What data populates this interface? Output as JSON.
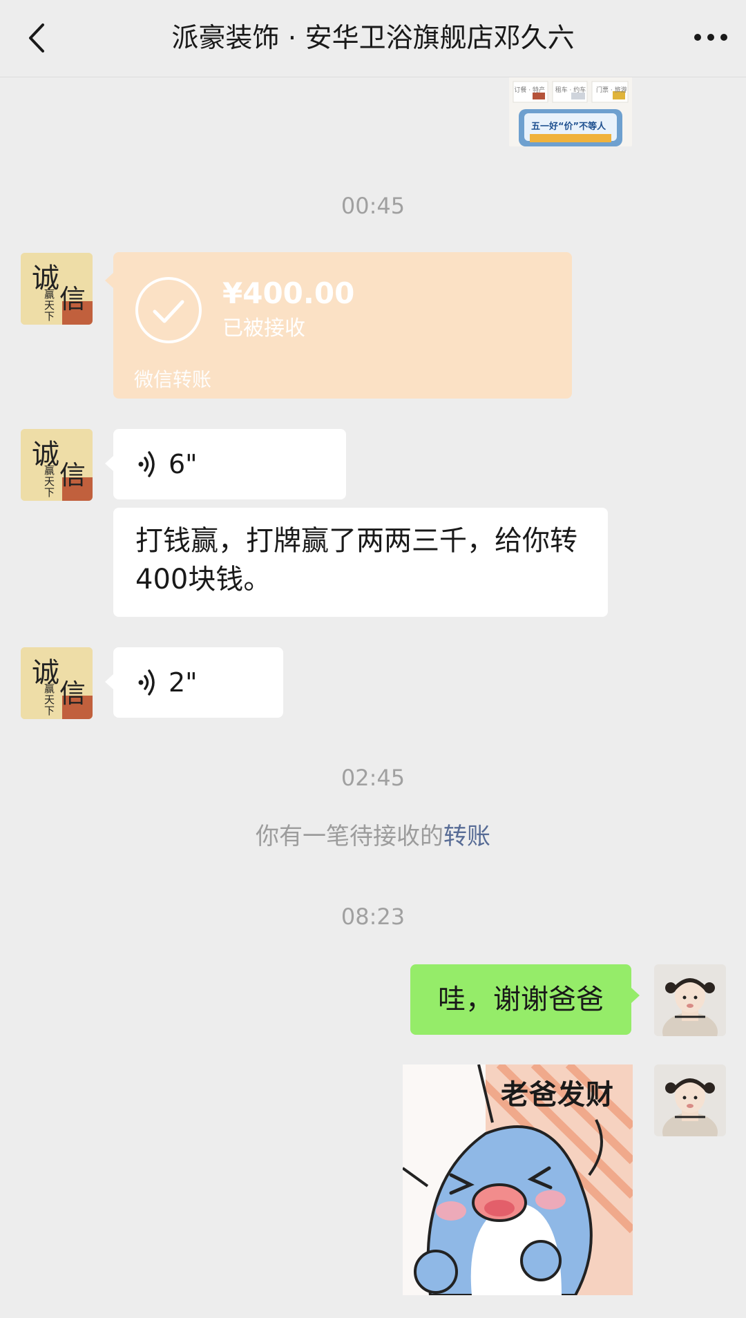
{
  "header": {
    "title": "派豪装饰 · 安华卫浴旗舰店邓久六",
    "back_icon": "chevron-left-icon",
    "more_icon": "more-dots-icon"
  },
  "previous_image": {
    "caption": "五一好“价”不等人",
    "tabs": [
      "订餐 · 特产",
      "租车 · 约车",
      "门票 · 旅游"
    ]
  },
  "timestamps": [
    "00:45",
    "02:45",
    "08:23"
  ],
  "contact_avatar": {
    "big1": "诚",
    "big2": "信",
    "small": "赢天下"
  },
  "transfer": {
    "amount": "¥400.00",
    "status": "已被接收",
    "label": "微信转账"
  },
  "voice_messages": [
    "6\"",
    "2\""
  ],
  "text_message": "打钱赢，打牌赢了两两三千，给你转400块钱。",
  "system_notice": {
    "prefix": "你有一笔待接收的",
    "link": "转账"
  },
  "my_message": "哇，谢谢爸爸",
  "sticker": {
    "text": "老爸发财"
  },
  "colors": {
    "background": "#ededed",
    "transfer_bubble": "#fbe1c5",
    "my_bubble": "#95ec69",
    "link": "#576b95"
  }
}
